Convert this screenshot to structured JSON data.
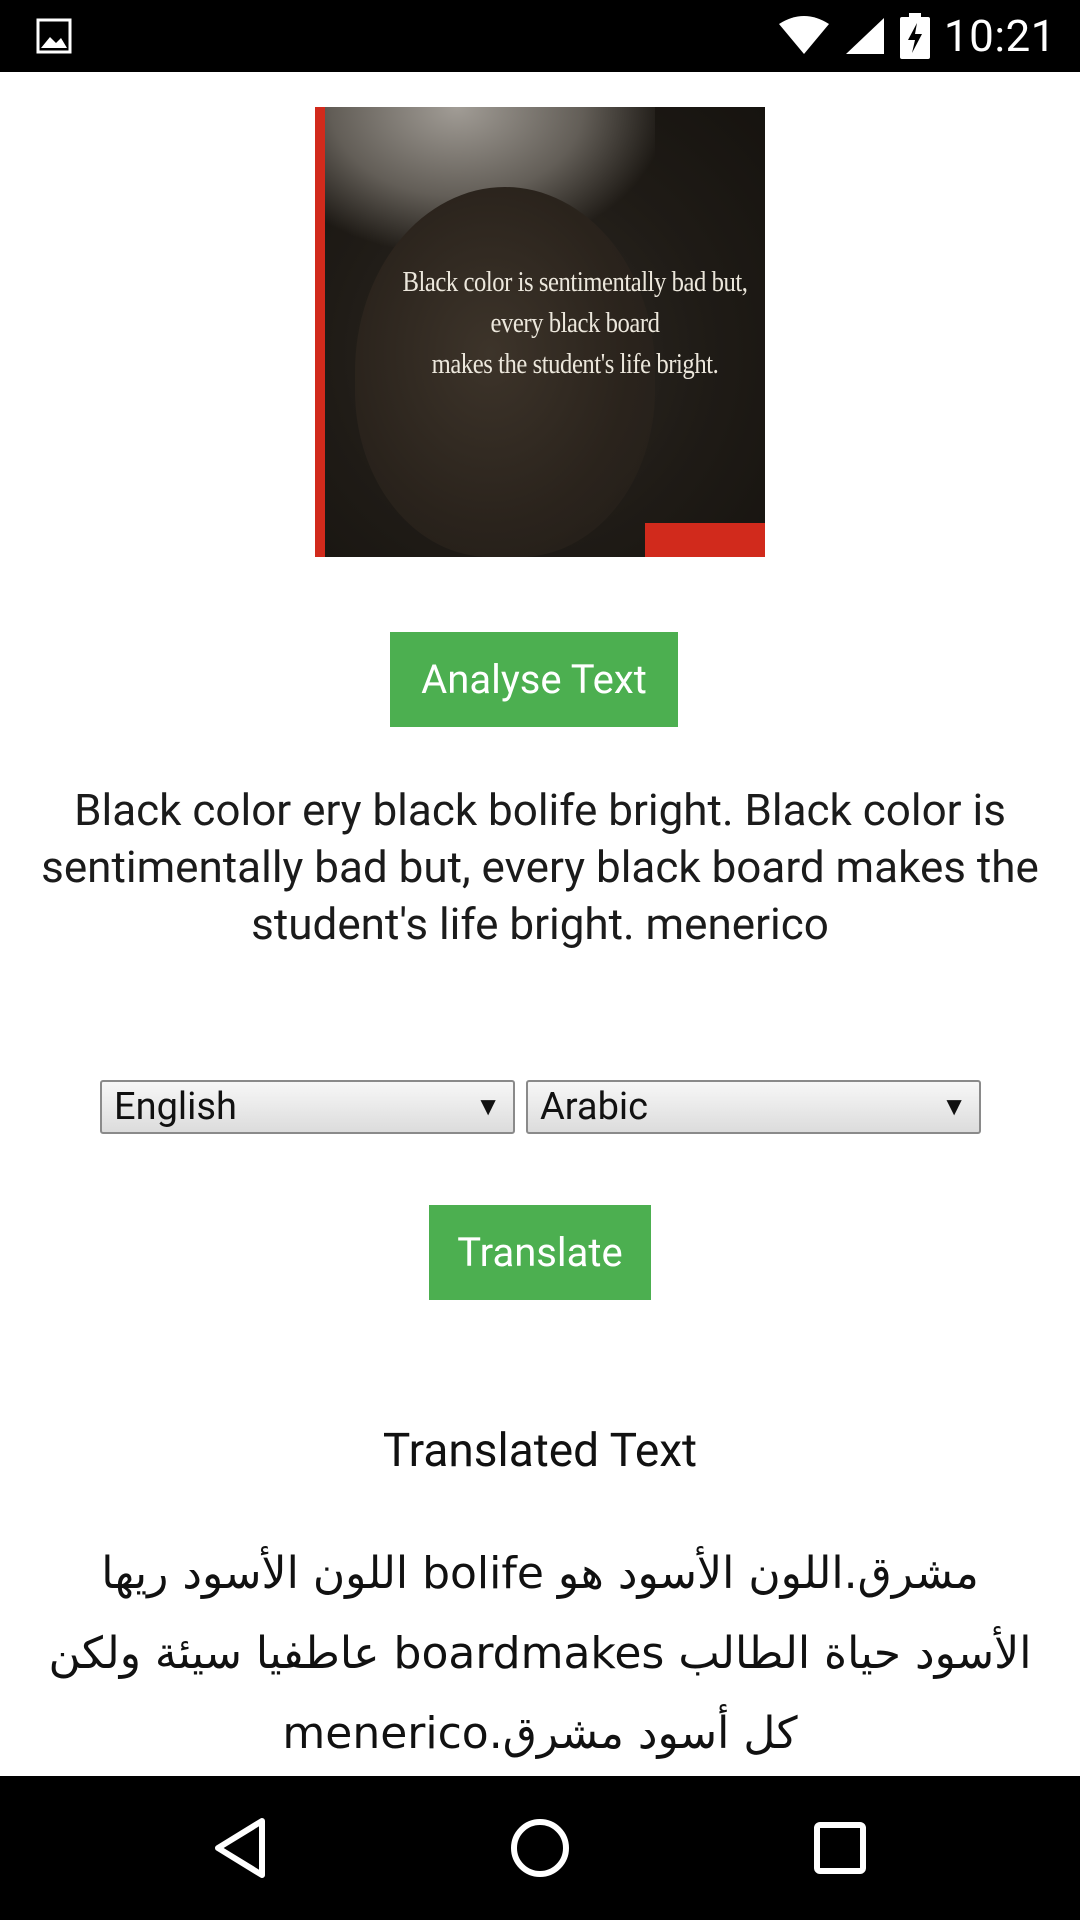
{
  "status_bar": {
    "time": "10:21",
    "icons": [
      "image-notification-icon",
      "wifi-icon",
      "cell-signal-icon",
      "battery-charging-icon"
    ]
  },
  "image": {
    "description_icon": "photo-icon",
    "quote_lines": [
      "Black color is sentimentally bad but,",
      "every black board",
      "makes the student's life bright."
    ]
  },
  "actions": {
    "analyse_label": "Analyse Text",
    "translate_label": "Translate"
  },
  "recognized_text": "Black color ery black bolife bright. Black color is sentimentally bad but, every black board makes the student's life bright. menerico",
  "languages": {
    "from": "English",
    "to": "Arabic"
  },
  "translation": {
    "heading": "Translated Text",
    "text": "مشرق.اللون الأسود هو bolife اللون الأسود ريها الأسود حياة الطالب boardmakes عاطفيا سيئة ولكن كل أسود مشرق.menerico"
  },
  "nav_bar": {
    "icons": [
      "back-icon",
      "home-icon",
      "recents-icon"
    ]
  },
  "colors": {
    "accent_button": "#4caf50",
    "status_bar": "#000000",
    "nav_bar": "#000000"
  }
}
